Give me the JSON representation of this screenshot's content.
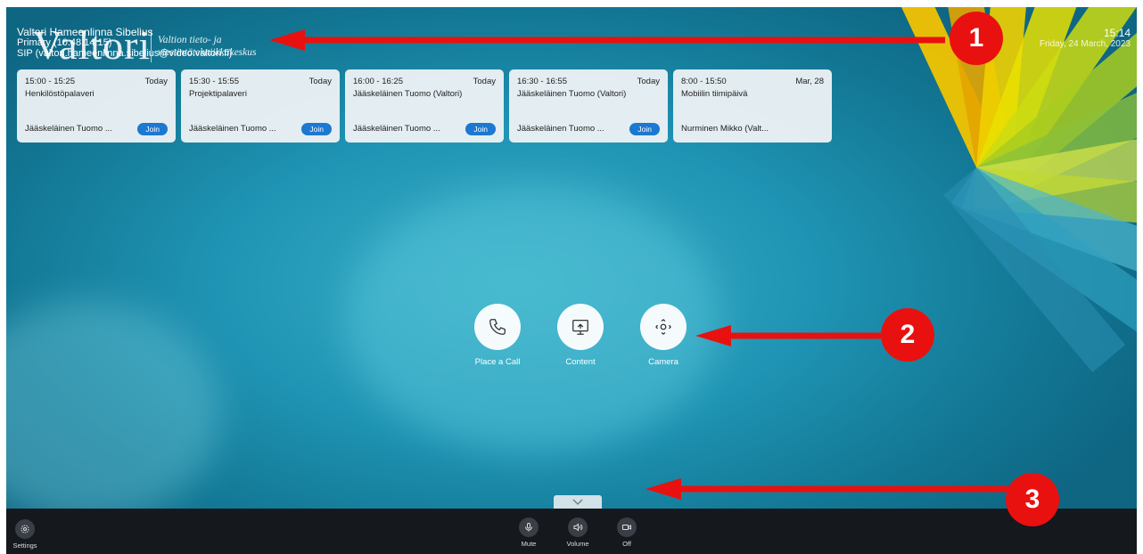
{
  "header": {
    "logo_word": "Valtori",
    "logo_tagline": "Valtion tieto- ja viestintätekniikkakeskus",
    "system_name": "Valtori Hameenlinna Sibelius",
    "primary": "Primary (10.48.14.15)",
    "sip": "SIP (valtori.hameenlinna.sibelius@video.valtori.fi)"
  },
  "clock": {
    "time": "15:14",
    "date": "Friday, 24 March, 2023"
  },
  "meetings": [
    {
      "time": "15:00 - 15:25",
      "day": "Today",
      "title": "Henkilöstöpalaveri",
      "organizer": "Jääskeläinen Tuomo ...",
      "join": "Join"
    },
    {
      "time": "15:30 - 15:55",
      "day": "Today",
      "title": "Projektipalaveri",
      "organizer": "Jääskeläinen Tuomo ...",
      "join": "Join"
    },
    {
      "time": "16:00 - 16:25",
      "day": "Today",
      "title": "Jääskeläinen Tuomo (Valtori)",
      "organizer": "Jääskeläinen Tuomo ...",
      "join": "Join"
    },
    {
      "time": "16:30 - 16:55",
      "day": "Today",
      "title": "Jääskeläinen Tuomo (Valtori)",
      "organizer": "Jääskeläinen Tuomo ...",
      "join": "Join"
    },
    {
      "time": "8:00 - 15:50",
      "day": "Mar, 28",
      "title": "Mobiilin tiimipäivä",
      "organizer": "Nurminen Mikko (Valt...",
      "join": ""
    }
  ],
  "actions": [
    {
      "label": "Place a Call",
      "icon": "phone-icon"
    },
    {
      "label": "Content",
      "icon": "share-screen-icon"
    },
    {
      "label": "Camera",
      "icon": "camera-control-icon"
    }
  ],
  "bottombar": {
    "settings": "Settings",
    "mute": "Mute",
    "volume": "Volume",
    "video": "Off"
  },
  "annotations": [
    "1",
    "2",
    "3"
  ],
  "colors": {
    "accent": "#1c78d1",
    "annotation": "#e8110f"
  }
}
